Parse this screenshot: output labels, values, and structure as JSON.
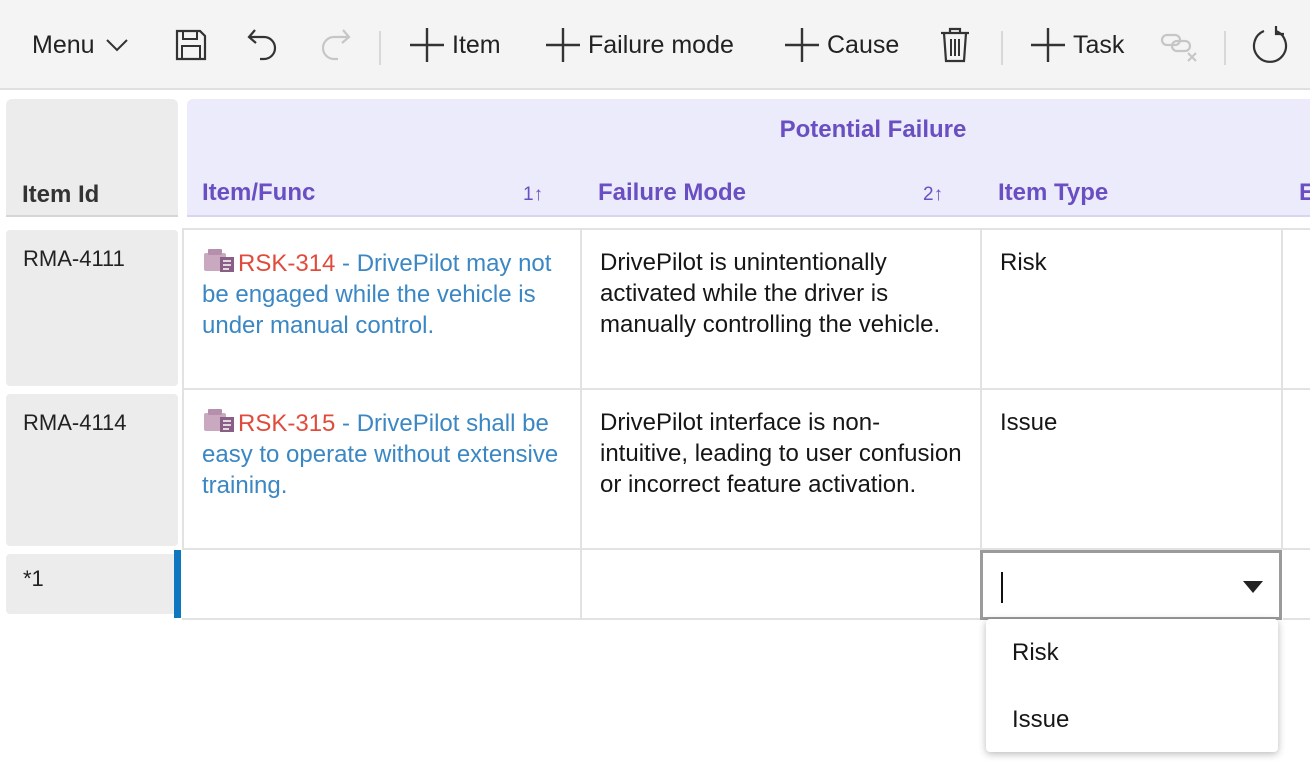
{
  "toolbar": {
    "menu_label": "Menu",
    "item_label": "Item",
    "failure_mode_label": "Failure mode",
    "cause_label": "Cause",
    "task_label": "Task"
  },
  "grid": {
    "id_header": "Item Id",
    "group_title": "Potential Failure",
    "columns": [
      {
        "label": "Item/Func",
        "sort": "1↑"
      },
      {
        "label": "Failure Mode",
        "sort": "2↑"
      },
      {
        "label": "Item Type"
      },
      {
        "label": "E"
      }
    ],
    "rows": [
      {
        "id": "RMA-4111",
        "item_ref": "RSK-314",
        "item_text": " - DrivePilot may not be engaged while the vehicle is under manual control.",
        "failure_mode": "DrivePilot is unintentionally activated while the driver is manually controlling the vehicle.",
        "item_type": "Risk"
      },
      {
        "id": "RMA-4114",
        "item_ref": "RSK-315",
        "item_text": " - DrivePilot shall be easy to operate without extensive training.",
        "failure_mode": "DrivePilot interface is non-intuitive, leading to user confusion or incorrect feature activation.",
        "item_type": "Issue"
      },
      {
        "id": "*1"
      }
    ],
    "dropdown_options": [
      "Risk",
      "Issue"
    ]
  },
  "colors": {
    "accent": "#0f77c0",
    "header_text": "#6a4fc2",
    "link": "#3b87c4",
    "item_id": "#e04b3b"
  },
  "icons": [
    "chevron-down-icon",
    "save-icon",
    "undo-icon",
    "redo-icon",
    "plus-icon",
    "trash-icon",
    "unlink-icon",
    "refresh-icon",
    "risk-item-icon",
    "dropdown-arrow-icon"
  ]
}
